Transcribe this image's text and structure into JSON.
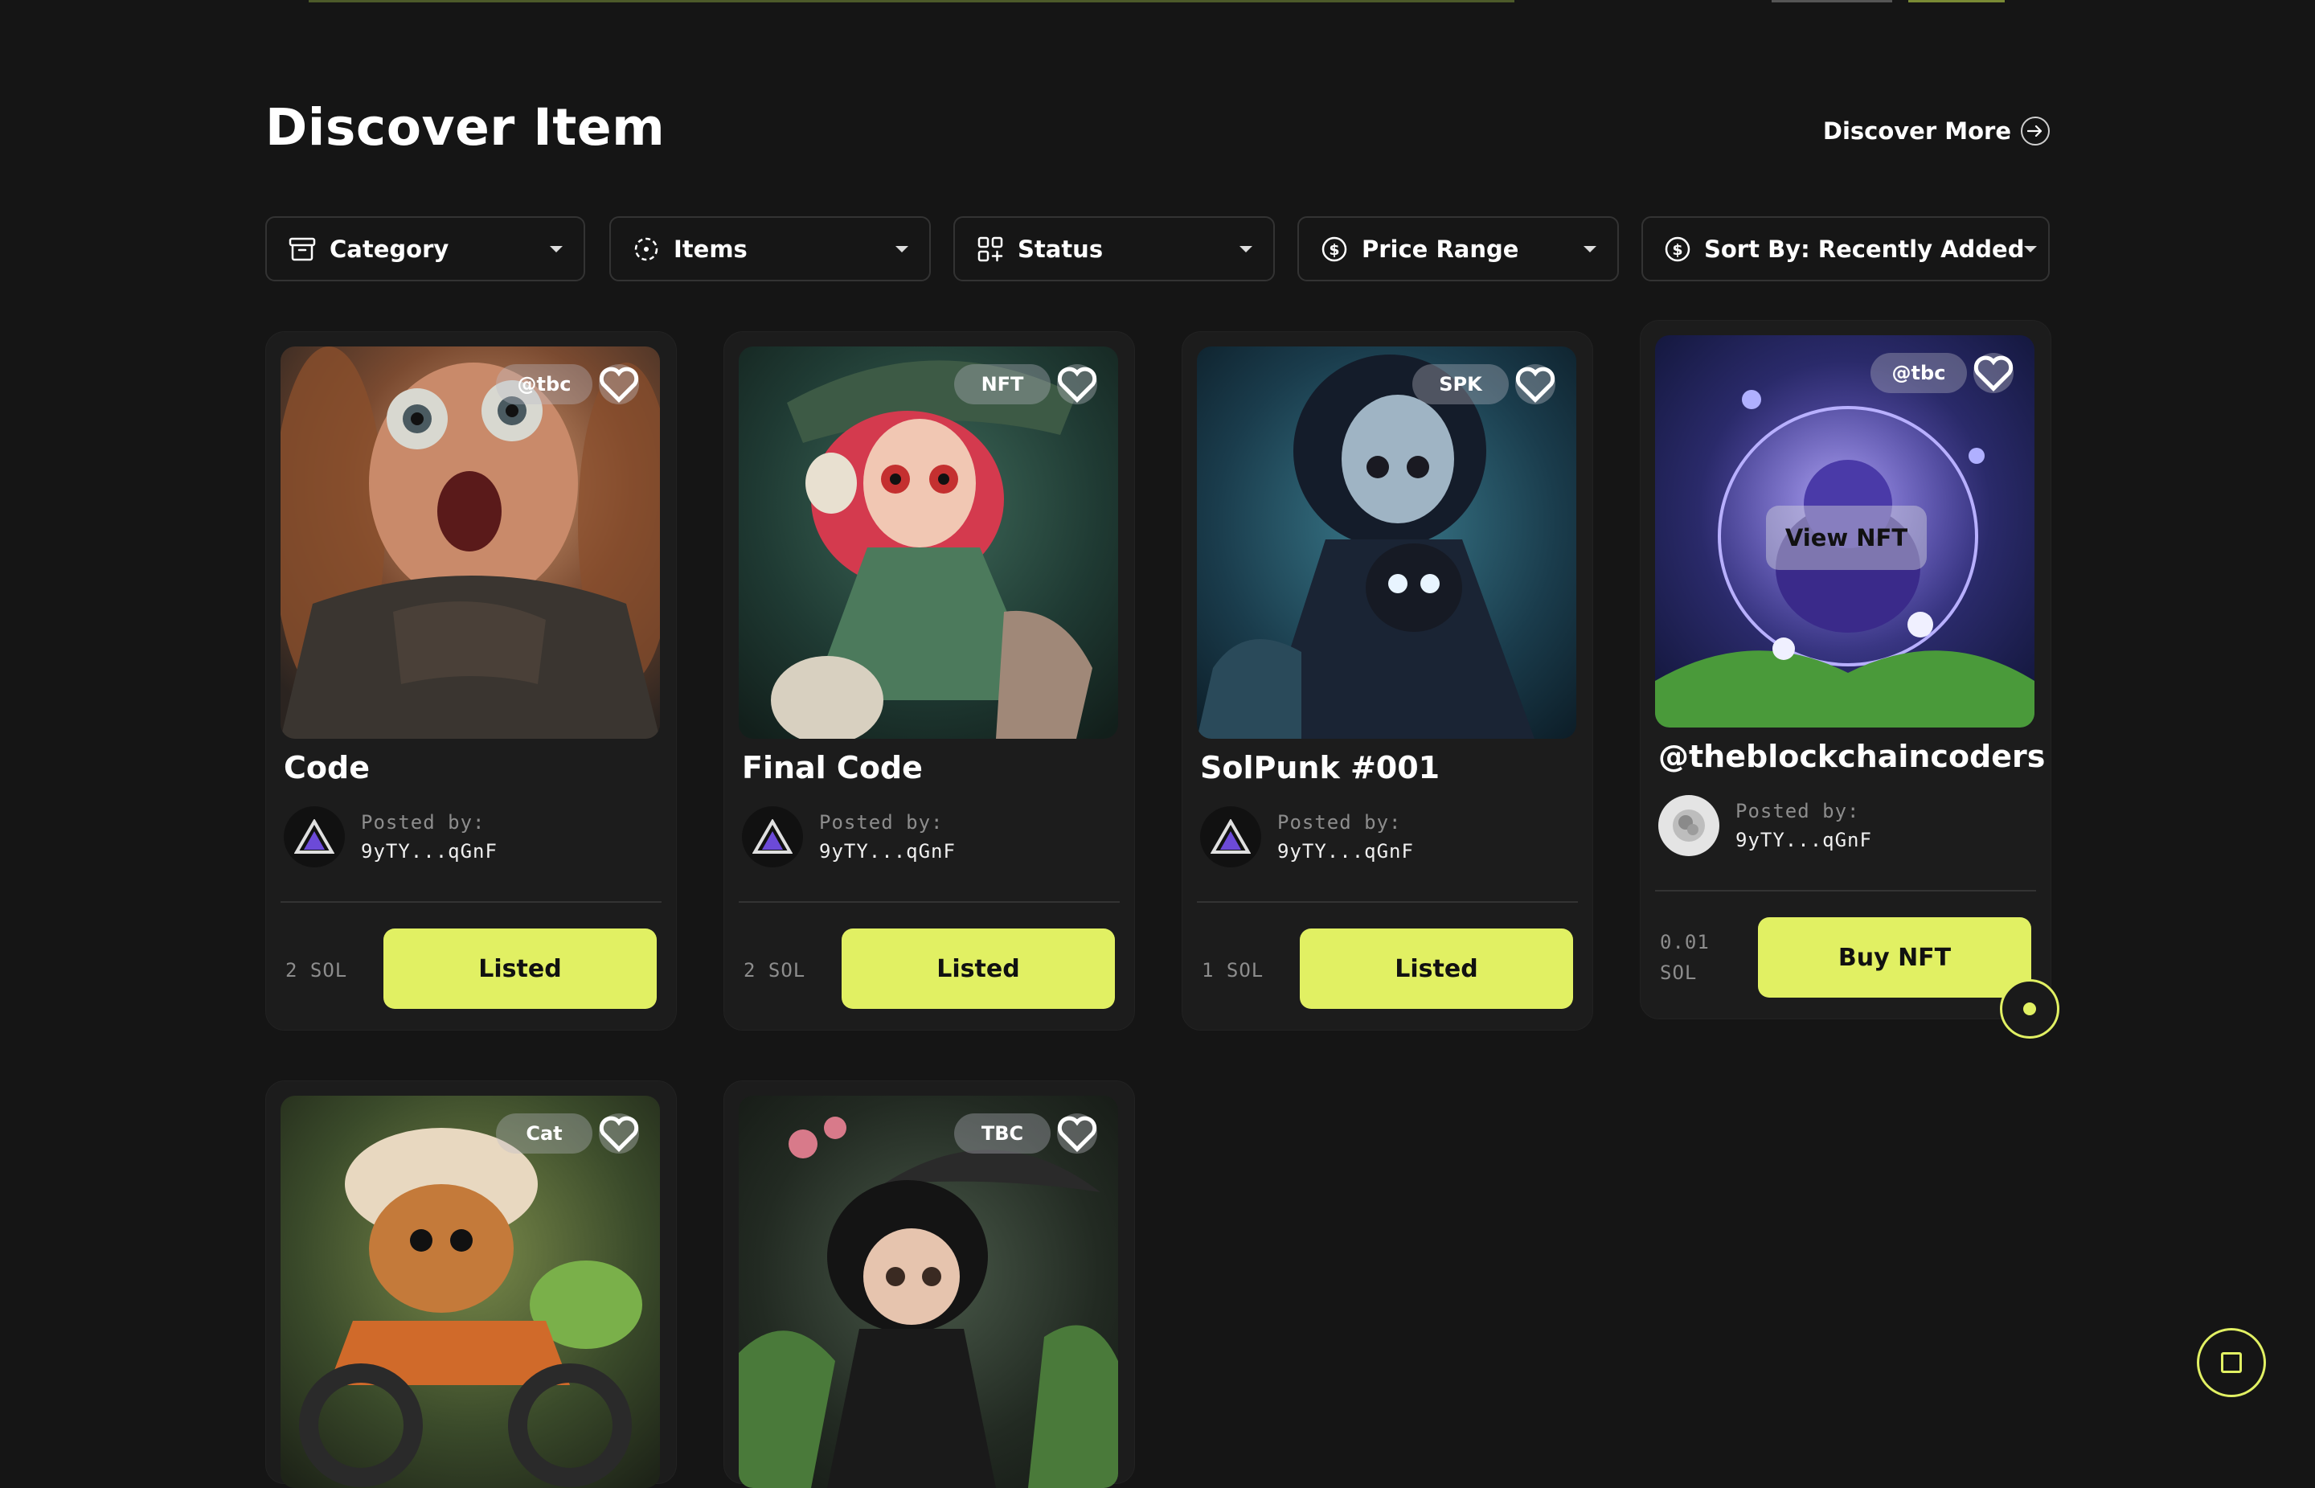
{
  "page": {
    "title": "Discover Item",
    "discover_more": "Discover More",
    "accent": "#e1f063",
    "background": "#151515"
  },
  "filters": [
    {
      "label": "Category",
      "icon": "archive-icon"
    },
    {
      "label": "Items",
      "icon": "items-icon"
    },
    {
      "label": "Status",
      "icon": "grid-icon"
    },
    {
      "label": "Price Range",
      "icon": "dollar-icon"
    },
    {
      "label": "Sort By: Recently Added",
      "icon": "dollar-icon"
    }
  ],
  "cards": [
    {
      "name": "Code",
      "tag": "@tbc",
      "posted_label": "Posted by:",
      "poster": "9yTY...qGnF",
      "price": "2 SOL",
      "action": "Listed",
      "image": "portrait-angry-character"
    },
    {
      "name": "Final Code",
      "tag": "NFT",
      "posted_label": "Posted by:",
      "poster": "9yTY...qGnF",
      "price": "2 SOL",
      "action": "Listed",
      "image": "portrait-red-haired-witch"
    },
    {
      "name": "SolPunk #001",
      "tag": "SPK",
      "posted_label": "Posted by:",
      "poster": "9yTY...qGnF",
      "price": "1 SOL",
      "action": "Listed",
      "image": "portrait-girl-with-cat"
    },
    {
      "name": "@theblockchaincoders",
      "tag": "@tbc",
      "posted_label": "Posted by:",
      "poster": "9yTY...qGnF",
      "price_value": "0.01",
      "price_unit": "SOL",
      "action": "Buy NFT",
      "hover_label": "View NFT",
      "image": "purple-creature-in-bubble"
    },
    {
      "tag": "Cat",
      "image": "furry-creature-on-motorbike"
    },
    {
      "tag": "TBC",
      "image": "girl-with-umbrella"
    }
  ]
}
